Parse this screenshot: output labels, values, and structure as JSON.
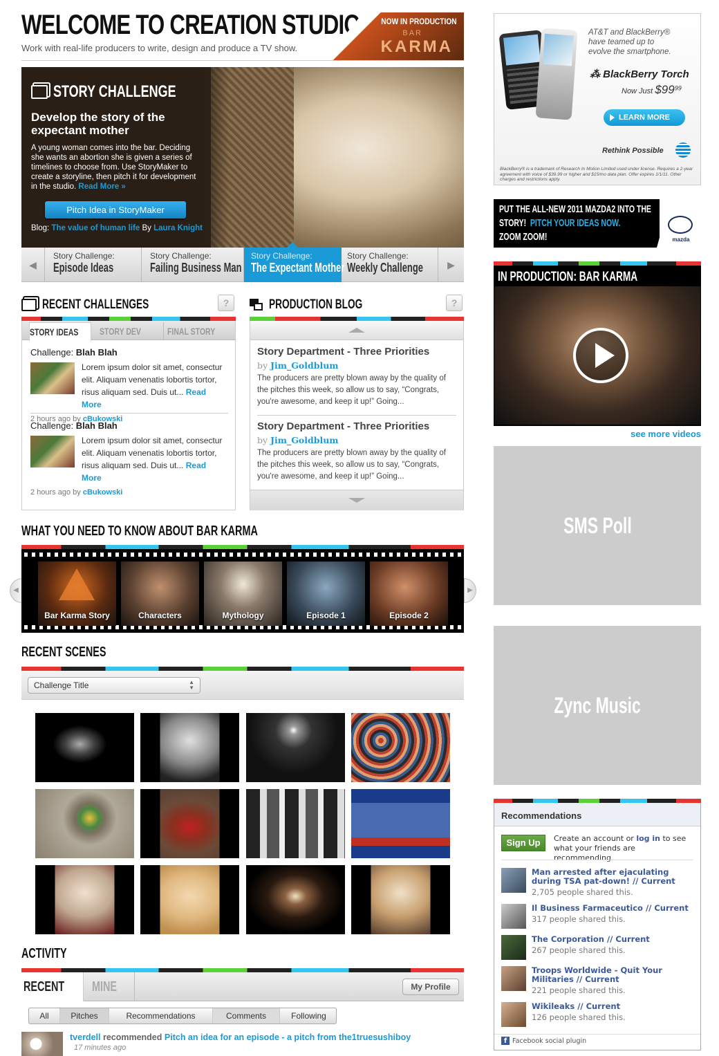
{
  "header": {
    "title": "WELCOME TO CREATION STUDIOS",
    "subtitle": "Work with real-life producers to write, design and produce a TV show.",
    "badge_line1": "NOW IN PRODUCTION",
    "badge_line2": "BAR",
    "badge_line3": "KARMA"
  },
  "hero": {
    "section_label": "STORY CHALLENGE",
    "headline": "Develop the story of the expectant mother",
    "body": "A young woman comes into the bar.  Deciding she wants an abortion she is given a series of timelines to choose from. Use StoryMaker to create a storyline, then pitch it for development in the studio.",
    "read_more": "Read More »",
    "cta": "Pitch Idea in StoryMaker",
    "blog_prefix": "Blog:",
    "blog_link": "The value of human life",
    "blog_by": "By",
    "blog_author": "Laura Knight"
  },
  "challenge_tabs": [
    {
      "kicker": "Story Challenge:",
      "title": "Episode Ideas"
    },
    {
      "kicker": "Story Challenge:",
      "title": "Failing Business Man"
    },
    {
      "kicker": "Story Challenge:",
      "title": "The Expectant Mother"
    },
    {
      "kicker": "Story Challenge:",
      "title": "Weekly Challenge"
    }
  ],
  "recent_challenges": {
    "heading": "RECENT CHALLENGES",
    "help": "?",
    "tabs": [
      "STORY IDEAS",
      "STORY DEV",
      "FINAL STORY"
    ],
    "items": [
      {
        "label": "Challenge:",
        "name": "Blah Blah",
        "text": "Lorem ipsum dolor sit amet, consectur elit. Aliquam venenatis lobortis tortor, risus aliquam sed. Duis ut...",
        "more": "Read More",
        "time": "2 hours ago",
        "by": "by",
        "user": "cBukowski"
      },
      {
        "label": "Challenge:",
        "name": "Blah Blah",
        "text": "Lorem ipsum dolor sit amet, consectur elit. Aliquam venenatis lobortis tortor, risus aliquam sed. Duis ut...",
        "more": "Read More",
        "time": "2 hours ago",
        "by": "by",
        "user": "cBukowski"
      }
    ]
  },
  "production_blog": {
    "heading": "PRODUCTION BLOG",
    "help": "?",
    "items": [
      {
        "title": "Story Department - Three Priorities",
        "by": "by",
        "author": "Jim_Goldblum",
        "text": "The producers are pretty blown away by the quality of the pitches this week, so allow us to say, “Congrats, you're awesome, and keep it up!” Going..."
      },
      {
        "title": "Story Department - Three Priorities",
        "by": "by",
        "author": "Jim_Goldblum",
        "text": "The producers are pretty blown away by the quality of the pitches this week, so allow us to say, “Congrats, you're awesome, and keep it up!” Going..."
      }
    ]
  },
  "know": {
    "heading": "WHAT YOU NEED TO KNOW ABOUT BAR KARMA",
    "items": [
      "Bar Karma Story",
      "Characters",
      "Mythology",
      "Episode 1",
      "Episode 2"
    ]
  },
  "scenes": {
    "heading": "RECENT SCENES",
    "select": "Challenge Title"
  },
  "activity": {
    "heading": "ACTIVITY",
    "tab_recent": "RECENT",
    "tab_mine": "MINE",
    "profile": "My Profile",
    "filters": [
      "All",
      "Pitches",
      "Recommendations",
      "Comments",
      "Following"
    ],
    "entry": {
      "user": "tverdell",
      "verb": "recommended",
      "link": "Pitch an idea for an episode - a pitch from the1truesushiboy",
      "time": "17 minutes ago"
    }
  },
  "ad_bb": {
    "line1": "AT&T and BlackBerry®",
    "line2": "have teamed up to",
    "line3": "evolve the smartphone.",
    "brand": "BlackBerry Torch",
    "price_prefix": "Now Just",
    "price": "$99",
    "price_cents": "99",
    "cta": "LEARN MORE",
    "tagline": "Rethink Possible",
    "fine": "BlackBerry® is a trademark of Research In Motion Limited used under license. Requires a 2-year agreement with voice of $39.99 or higher and $15/mo data plan. Offer expires 1/1/11. Other charges and restrictions apply."
  },
  "ad_mazda": {
    "line1": "PUT THE ALL-NEW 2011 MAZDA2 INTO THE",
    "line2a": "STORY!",
    "line2b": "PITCH YOUR IDEAS NOW.",
    "line3": "ZOOM ZOOM!",
    "logo": "mazda"
  },
  "video": {
    "heading": "IN PRODUCTION: BAR KARMA",
    "more": "see more videos"
  },
  "sms_poll": "SMS Poll",
  "zync": "Zync Music",
  "recommendations": {
    "heading": "Recommendations",
    "signup": "Sign Up",
    "prompt_a": "Create an account or",
    "prompt_link": "log in",
    "prompt_b": "to see what your friends are recommending.",
    "items": [
      {
        "title": "Man arrested after ejaculating during TSA pat-down! // Current",
        "shares": "2,705 people shared this."
      },
      {
        "title": "Il Business Farmaceutico // Current",
        "shares": "317 people shared this."
      },
      {
        "title": "The Corporation // Current",
        "shares": "267 people shared this."
      },
      {
        "title": "Troops Worldwide - Quit Your Militaries // Current",
        "shares": "221 people shared this."
      },
      {
        "title": "Wikileaks // Current",
        "shares": "126 people shared this."
      }
    ],
    "footer": "Facebook social plugin"
  },
  "colors": {
    "accent": "#1a9ad6",
    "facebook": "#3b5998",
    "signup": "#5a9a3c"
  }
}
